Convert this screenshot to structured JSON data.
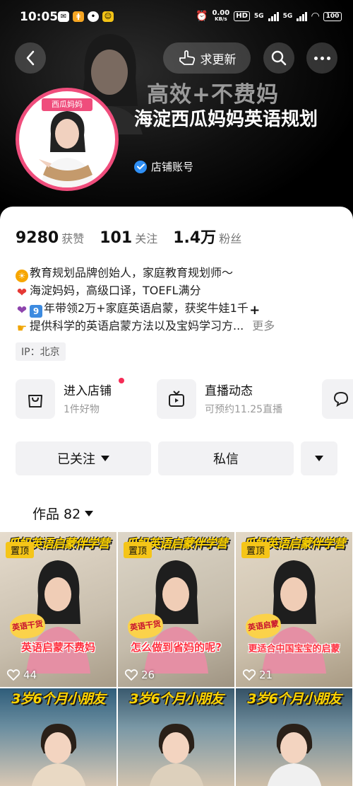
{
  "status_bar": {
    "time": "10:05",
    "net_speed_value": "0.00",
    "net_speed_unit": "KB/s",
    "hd_label": "HD",
    "sig1_label": "5G",
    "sig2_label": "5G",
    "battery": "100"
  },
  "header": {
    "seek_update_label": "求更新",
    "slogan": "高效+不费妈",
    "avatar_title": "西瓜妈妈",
    "name": "海淀西瓜妈妈英语规划",
    "account_type": "店铺账号"
  },
  "stats": {
    "likes_value": "9280",
    "likes_label": "获赞",
    "following_value": "101",
    "following_label": "关注",
    "fans_value": "1.4万",
    "fans_label": "粉丝"
  },
  "bio": {
    "line1": "教育规划品牌创始人，家庭教育规划师～",
    "line2": "海淀妈妈，高级口译，TOEFL满分",
    "line3_num": "9",
    "line3": "年带领2万+家庭英语启蒙，获奖牛娃1千",
    "line4": "提供科学的英语启蒙方法以及宝妈学习方...",
    "more": "更多"
  },
  "ip_label": "IP：北京",
  "shop": {
    "title": "进入店铺",
    "sub": "1件好物"
  },
  "live": {
    "title": "直播动态",
    "sub": "可预约11.25直播"
  },
  "buttons": {
    "follow": "已关注",
    "dm": "私信"
  },
  "works_tab": "作品 82",
  "videos": [
    {
      "banner": "瓜妈英语启蒙伴学营",
      "pinned": "置顶",
      "chip": "英语干货",
      "caption": "英语启蒙不费妈",
      "likes": "44"
    },
    {
      "banner": "瓜妈英语启蒙伴学营",
      "pinned": "置顶",
      "chip": "英语干货",
      "caption": "怎么做到省妈的呢?",
      "likes": "26"
    },
    {
      "banner": "瓜妈英语启蒙伴学营",
      "pinned": "置顶",
      "chip": "英语启蒙",
      "caption": "更适合中国宝宝的启蒙",
      "likes": "21"
    },
    {
      "banner": "3岁6个月小朋友"
    },
    {
      "banner": "3岁6个月小朋友"
    },
    {
      "banner": "3岁6个月小朋友"
    }
  ],
  "colors": {
    "accent_pink": "#ef4d7c",
    "verified_blue": "#2f8ff5",
    "notify_red": "#f52c56",
    "pin_yellow": "#f5c518"
  },
  "icons": [
    "back-icon",
    "hand-pointer-icon",
    "search-icon",
    "more-icon",
    "verified-icon",
    "shopping-bag-icon",
    "tv-icon",
    "chat-icon",
    "heart-icon",
    "caret-down-icon"
  ]
}
